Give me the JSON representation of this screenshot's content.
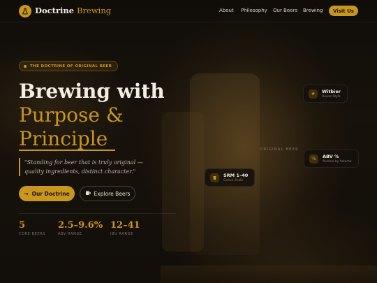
{
  "brand": {
    "name_part1": "Doctrine",
    "name_part2": "Brewing"
  },
  "nav": {
    "items": [
      {
        "label": "About"
      },
      {
        "label": "Philosophy"
      },
      {
        "label": "Our Beers"
      },
      {
        "label": "Brewing"
      }
    ],
    "cta_label": "Visit Us"
  },
  "hero": {
    "eyebrow": "THE DOCTRINE OF ORIGINAL BEER",
    "title_line1": "Brewing with",
    "title_line2": "Purpose &",
    "title_line3": "Principle",
    "quote_line1": "\"Standing for beer that is truly original —",
    "quote_line2": "quality ingredients, distinct character.\"",
    "primary_button": "Our Doctrine",
    "secondary_button": "Explore Beers"
  },
  "stats": [
    {
      "value": "5",
      "label": "CORE BEERS"
    },
    {
      "value": "2.5–9.6%",
      "label": "ABV RANGE"
    },
    {
      "value": "12–41",
      "label": "IBU RANGE"
    }
  ],
  "cards": {
    "witbier": {
      "title": "Witbier",
      "subtitle": "House Style",
      "icon": "star-icon"
    },
    "abv": {
      "title": "ABV %",
      "subtitle": "Alcohol by Volume",
      "icon": "percent-icon"
    },
    "srm": {
      "title": "SRM 1–40",
      "subtitle": "Colour Scale",
      "icon": "glass-icon"
    }
  },
  "image_label": "ORIGINAL BEER",
  "colors": {
    "accent": "#c9961e",
    "background": "#0f0c08"
  }
}
